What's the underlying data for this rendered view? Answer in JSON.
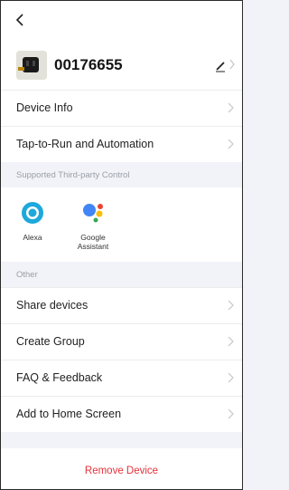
{
  "header": {
    "back_icon": "chevron-left-icon"
  },
  "device": {
    "name": "00176655",
    "edit_icon": "pencil-icon"
  },
  "menu_top": [
    {
      "label": "Device Info"
    },
    {
      "label": "Tap-to-Run and Automation"
    }
  ],
  "third_party": {
    "section_title": "Supported Third-party Control",
    "items": [
      {
        "label": "Alexa",
        "icon": "alexa-icon"
      },
      {
        "label": "Google\nAssistant",
        "icon": "google-assistant-icon"
      }
    ]
  },
  "other": {
    "section_title": "Other",
    "items": [
      {
        "label": "Share devices"
      },
      {
        "label": "Create Group"
      },
      {
        "label": "FAQ & Feedback"
      },
      {
        "label": "Add to Home Screen"
      }
    ]
  },
  "remove_label": "Remove Device",
  "colors": {
    "background": "#f1f3f8",
    "danger": "#e4313a",
    "alexa": "#1ea8db",
    "google_blue": "#4285f4",
    "google_red": "#ea4335",
    "google_yellow": "#fbbc05",
    "google_green": "#34a853"
  }
}
